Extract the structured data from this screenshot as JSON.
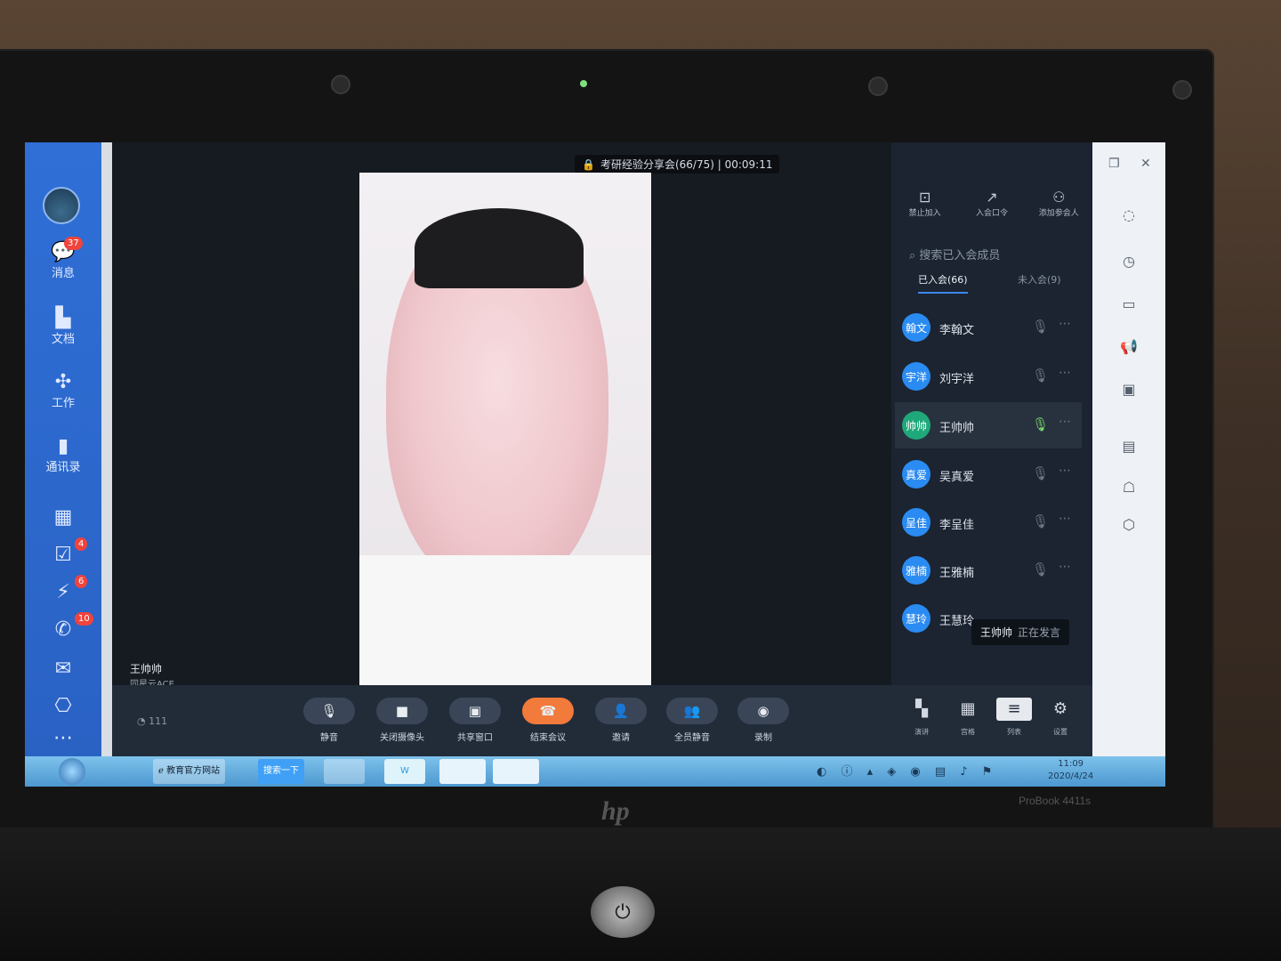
{
  "window": {
    "title": "考研经验分享会(66/75) | 00:09:11"
  },
  "sidebar": {
    "items": [
      {
        "label": "消息",
        "badge": "37"
      },
      {
        "label": "文档"
      },
      {
        "label": "工作"
      },
      {
        "label": "通讯录"
      }
    ],
    "icon_badges": [
      "4",
      "6",
      "10"
    ]
  },
  "speaker": {
    "name": "王帅帅",
    "org": "同星云ACE"
  },
  "panel": {
    "tools": [
      "禁止加入",
      "入会口令",
      "添加参会人"
    ],
    "search_placeholder": "搜索已入会成员",
    "tabs": [
      "已入会(66)",
      "未入会(9)"
    ],
    "members": [
      {
        "avatar": "翰文",
        "name": "李翰文",
        "speaking": false
      },
      {
        "avatar": "宇洋",
        "name": "刘宇洋",
        "speaking": false
      },
      {
        "avatar": "帅帅",
        "name": "王帅帅",
        "speaking": true
      },
      {
        "avatar": "真爱",
        "name": "吴真爱",
        "speaking": false
      },
      {
        "avatar": "呈佳",
        "name": "李呈佳",
        "speaking": false
      },
      {
        "avatar": "雅楠",
        "name": "王雅楠",
        "speaking": false
      },
      {
        "avatar": "慧玲",
        "name": "王慧玲",
        "speaking": false
      }
    ],
    "toast": {
      "name": "王帅帅",
      "status": "正在发言"
    }
  },
  "controls": {
    "buttons": [
      "静音",
      "关闭摄像头",
      "共享窗口",
      "结束会议",
      "邀请",
      "全员静音",
      "录制"
    ],
    "views": [
      "演讲",
      "宫格",
      "列表",
      "设置"
    ],
    "network": "111"
  },
  "taskbar": {
    "browser_label": "教育官方网站",
    "search_label": "搜索一下",
    "time": "11:09",
    "date": "2020/4/24"
  },
  "device": {
    "brand": "hp",
    "model": "ProBook 4411s"
  }
}
